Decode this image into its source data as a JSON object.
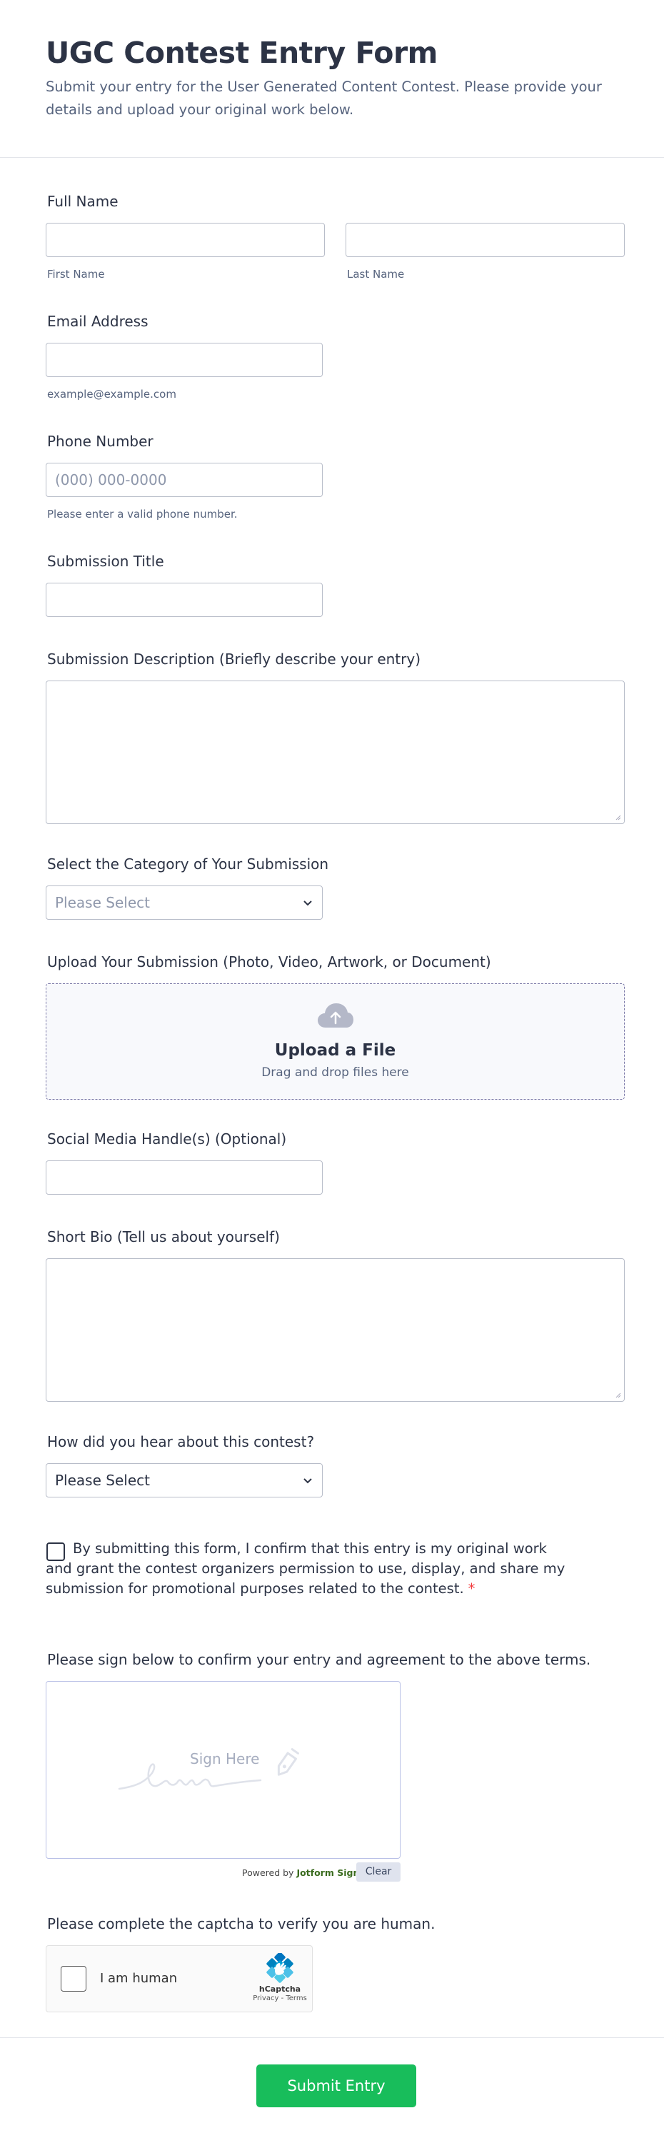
{
  "form": {
    "title": "UGC Contest Entry Form",
    "description": "Submit your entry for the User Generated Content Contest. Please provide your details and upload your original work below."
  },
  "full_name": {
    "label": "Full Name",
    "first_sublabel": "First Name",
    "last_sublabel": "Last Name",
    "first_value": "",
    "last_value": ""
  },
  "email": {
    "label": "Email Address",
    "sublabel": "example@example.com",
    "value": ""
  },
  "phone": {
    "label": "Phone Number",
    "placeholder": "(000) 000-0000",
    "sublabel": "Please enter a valid phone number."
  },
  "submission_title": {
    "label": "Submission Title",
    "value": ""
  },
  "submission_description": {
    "label": "Submission Description (Briefly describe your entry)",
    "value": ""
  },
  "category": {
    "label": "Select the Category of Your Submission",
    "selected": "Please Select"
  },
  "upload": {
    "label": "Upload Your Submission (Photo, Video, Artwork, or Document)",
    "title": "Upload a File",
    "subtitle": "Drag and drop files here",
    "icon": "cloud-upload-icon"
  },
  "social": {
    "label": "Social Media Handle(s) (Optional)",
    "value": ""
  },
  "bio": {
    "label": "Short Bio (Tell us about yourself)",
    "value": ""
  },
  "referral": {
    "label": "How did you hear about this contest?",
    "selected": "Please Select"
  },
  "terms": {
    "text": "By submitting this form, I confirm that this entry is my original work and grant the contest organizers permission to use, display, and share my submission for promotional purposes related to the contest.",
    "required_mark": "*",
    "checked": false
  },
  "signature": {
    "label": "Please sign below to confirm your entry and agreement to the above terms.",
    "placeholder": "Sign Here",
    "powered_prefix": "Powered by",
    "powered_brand": "Jotform Sign",
    "clear_label": "Clear"
  },
  "captcha": {
    "label": "Please complete the captcha to verify you are human.",
    "checkbox_text": "I am human",
    "brand": "hCaptcha",
    "links": "Privacy - Terms"
  },
  "submit": {
    "label": "Submit Entry"
  },
  "colors": {
    "accent_green": "#18bd5b",
    "text_dark": "#2c3345",
    "text_muted": "#57647e",
    "required_red": "#f23a3c"
  }
}
